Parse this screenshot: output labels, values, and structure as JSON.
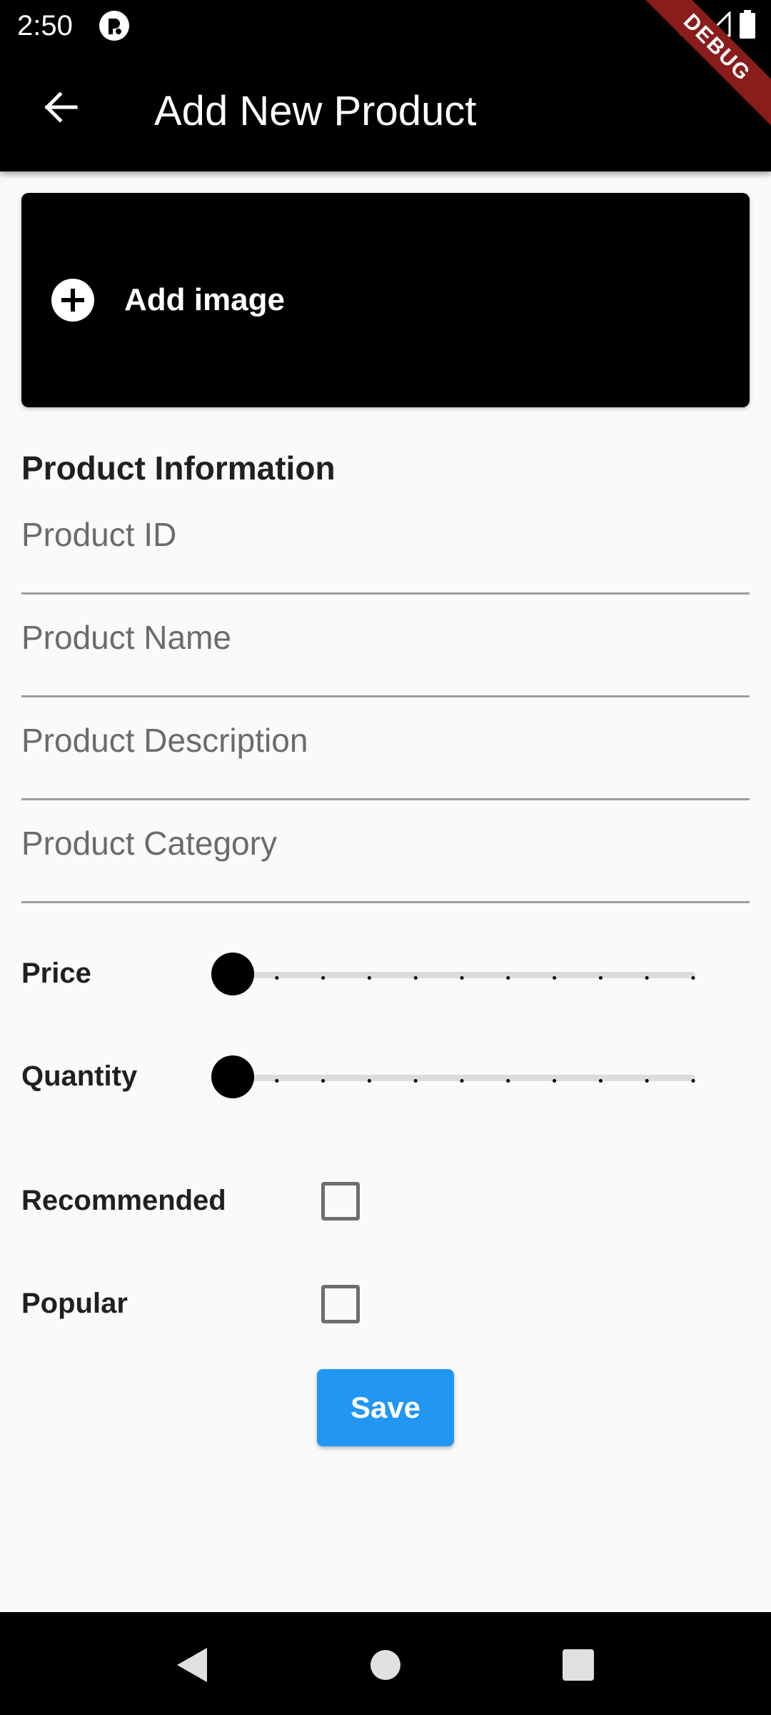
{
  "status_bar": {
    "time": "2:50",
    "icons": [
      "app-notification-icon",
      "wifi-icon",
      "cellular-signal-icon",
      "battery-icon"
    ]
  },
  "app_bar": {
    "title": "Add New Product",
    "back_icon": "arrow-back-icon",
    "debug_label": "DEBUG"
  },
  "image_picker": {
    "icon": "add-circle-icon",
    "label": "Add image"
  },
  "form": {
    "section_title": "Product Information",
    "fields": [
      {
        "placeholder": "Product ID",
        "value": ""
      },
      {
        "placeholder": "Product Name",
        "value": ""
      },
      {
        "placeholder": "Product Description",
        "value": ""
      },
      {
        "placeholder": "Product Category",
        "value": ""
      }
    ],
    "price": {
      "label": "Price",
      "level": 0,
      "divisions": 10
    },
    "quantity": {
      "label": "Quantity",
      "level": 0,
      "divisions": 10
    },
    "recommended": {
      "label": "Recommended",
      "checked": false
    },
    "popular": {
      "label": "Popular",
      "checked": false
    },
    "save_label": "Save"
  },
  "nav_bar": {
    "icons": [
      "back-triangle-icon",
      "home-circle-icon",
      "recents-square-icon"
    ]
  },
  "colors": {
    "app_bar": "#000000",
    "background": "#fafafa",
    "accent": "#2196f3",
    "debug_ribbon": "#8b1c1c"
  }
}
